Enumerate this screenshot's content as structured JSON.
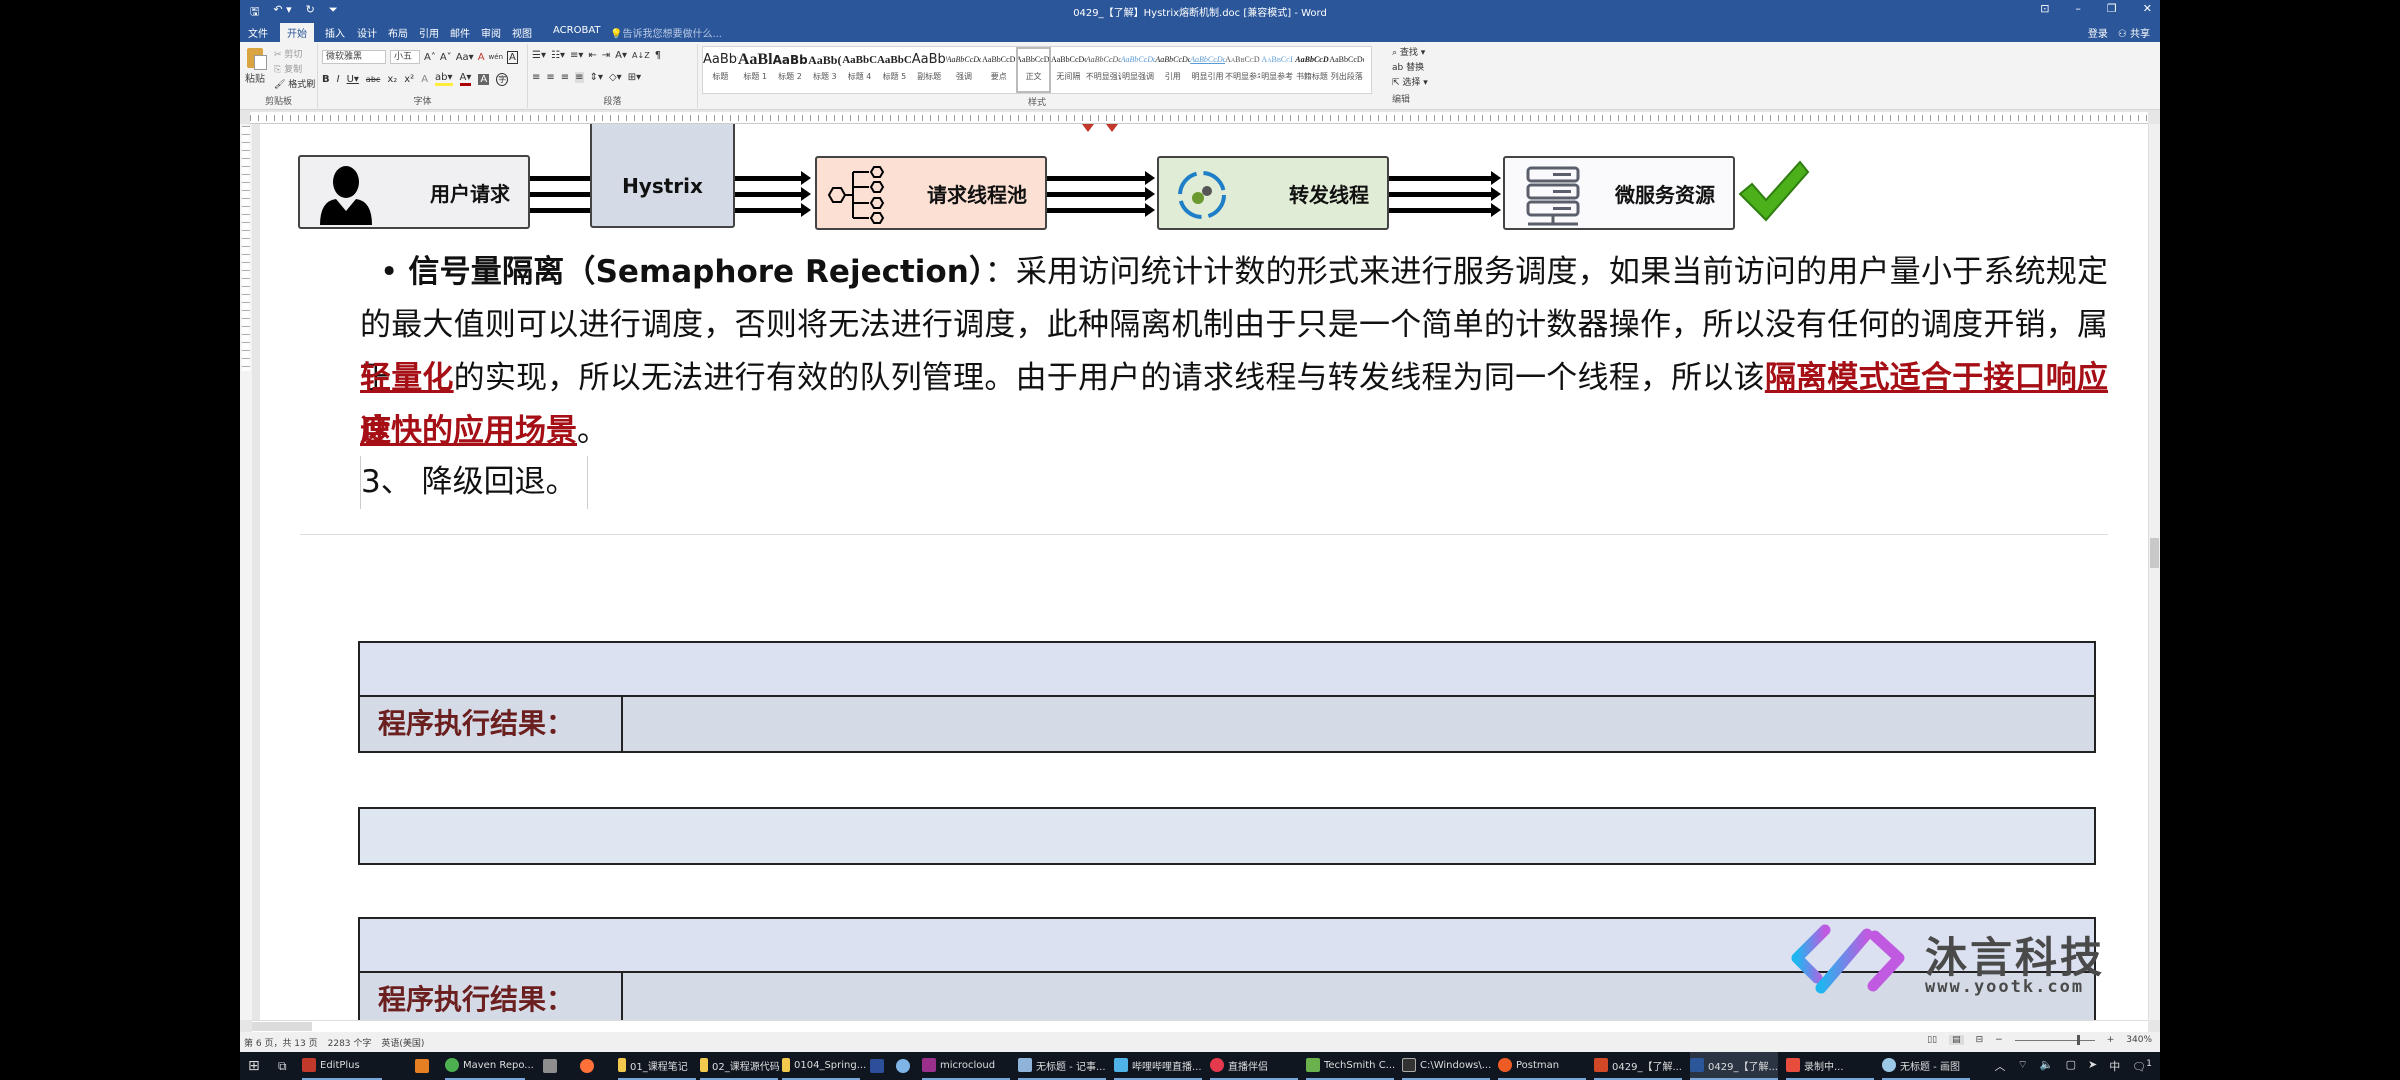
{
  "window": {
    "title": "0429_【了解】Hystrix熔断机制.doc [兼容模式] - Word",
    "qat": {
      "save": "🖫",
      "undo": "↶ ▾",
      "redo": "↻",
      "customize": "⏷"
    },
    "controls": {
      "ribbon_options": "⊡",
      "minimize": "–",
      "restore": "❐",
      "close": "✕"
    }
  },
  "tabs": [
    {
      "label": "文件"
    },
    {
      "label": "开始",
      "active": true
    },
    {
      "label": "插入"
    },
    {
      "label": "设计"
    },
    {
      "label": "布局"
    },
    {
      "label": "引用"
    },
    {
      "label": "邮件"
    },
    {
      "label": "审阅"
    },
    {
      "label": "视图"
    },
    {
      "label": "ACROBAT"
    }
  ],
  "tell_me": "告诉我您想要做什么...",
  "account": {
    "login": "登录",
    "share": "共享"
  },
  "ribbon": {
    "clipboard": {
      "paste": "粘贴",
      "cut": "剪切",
      "copy": "复制",
      "format_painter": "格式刷",
      "label": "剪贴板"
    },
    "font": {
      "name": "微软雅黑",
      "size": "小五",
      "label": "字体",
      "buttons": [
        "A˄",
        "A˅",
        "Aa▾",
        "A",
        "wén",
        "A",
        "B",
        "I",
        "U▾",
        "abc",
        "x₂",
        "x²",
        "A",
        "ab▾",
        "A▾",
        "A",
        "字"
      ]
    },
    "paragraph": {
      "label": "段落",
      "buttons": [
        "☰▾",
        "☷▾",
        "≡▾",
        "⇤",
        "⇥",
        "A▾",
        "A↓Z",
        "¶",
        "≡",
        "≡",
        "≡",
        "≡",
        "⇕▾",
        "◇▾",
        "⊞▾"
      ]
    },
    "styles": {
      "label": "样式",
      "items": [
        {
          "preview": "AaBbC",
          "name": "标题"
        },
        {
          "preview": "AaBl",
          "name": "标题 1"
        },
        {
          "preview": "AaBb(",
          "name": "标题 2"
        },
        {
          "preview": "AaBb(",
          "name": "标题 3"
        },
        {
          "preview": "AaBbC(",
          "name": "标题 4"
        },
        {
          "preview": "AaBbC",
          "name": "标题 5"
        },
        {
          "preview": "AaBbC",
          "name": "副标题"
        },
        {
          "preview": "AaBbCcDc",
          "name": "强调"
        },
        {
          "preview": "AaBbCcD",
          "name": "要点"
        },
        {
          "preview": "AaBbCcDc",
          "name": "正文",
          "selected": true
        },
        {
          "preview": "AaBbCcDc",
          "name": "无间隔"
        },
        {
          "preview": "AaBbCcDc",
          "name": "不明显强调"
        },
        {
          "preview": "AaBbCcDc",
          "name": "明显强调"
        },
        {
          "preview": "AaBbCcDc",
          "name": "引用"
        },
        {
          "preview": "AaBbCcDc",
          "name": "明显引用"
        },
        {
          "preview": "AaBbCcD",
          "name": "不明显参考"
        },
        {
          "preview": "AaBbCcI",
          "name": "明显参考"
        },
        {
          "preview": "AaBbCcD",
          "name": "书籍标题"
        },
        {
          "preview": "AaBbCcDc",
          "name": "列出段落"
        }
      ]
    },
    "editing": {
      "find": "查找",
      "replace": "替换",
      "select": "选择",
      "label": "编辑"
    }
  },
  "diagram": {
    "boxes": [
      {
        "label": "用户请求",
        "color": "#f0f0f3"
      },
      {
        "label": "Hystrix",
        "color": "#d5dbe6"
      },
      {
        "label": "请求线程池",
        "color": "#fbe0d3"
      },
      {
        "label": "转发线程",
        "color": "#e0ecd5"
      },
      {
        "label": "微服务资源",
        "color": "#fafafd"
      }
    ]
  },
  "content": {
    "bullet": "•",
    "term": "信号量隔离（Semaphore Rejection）",
    "colon": "：",
    "line1_rest": "采用访问统计计数的形式来进行服务调度，如果当前访问的用户量小于系统规定",
    "line2": "的最大值则可以进行调度，否则将无法进行调度，此种隔离机制由于只是一个简单的计数器操作，所以没有任何的调度开销，属于",
    "highlight1": "轻量化",
    "line3_mid": "的实现，所以无法进行有效的队列管理。由于用户的请求线程与转发线程为同一个线程，所以该",
    "highlight2a": "隔离模式适合于接口响应速",
    "highlight2b": "度快的应用场景",
    "end": "。",
    "heading3": "3、  降级回退。",
    "result_label": "程序执行结果："
  },
  "watermark": {
    "name": "沐言科技",
    "url": "www.yootk.com"
  },
  "statusbar": {
    "page": "第 6 页，共 13 页",
    "words": "2283 个字",
    "language": "英语(美国)",
    "zoom": "340%",
    "zoom_out": "−",
    "zoom_in": "+"
  },
  "taskbar": {
    "items": [
      {
        "label": "EditPlus",
        "color": "#c0392b"
      },
      {
        "label": "",
        "color": "#e67e22"
      },
      {
        "label": "Maven Repo...",
        "color": "#4caf50"
      },
      {
        "label": "",
        "color": "#8e8e8e"
      },
      {
        "label": "",
        "color": "#ff7139"
      },
      {
        "label": "01_课程笔记",
        "color": "#f2c94c"
      },
      {
        "label": "02_课程源代码",
        "color": "#f2c94c"
      },
      {
        "label": "0104_Spring...",
        "color": "#f2c94c"
      },
      {
        "label": "",
        "color": "#2d4e9a"
      },
      {
        "label": "",
        "color": "#7fb5e6"
      },
      {
        "label": "microcloud",
        "color": "#9b2f8c"
      },
      {
        "label": "无标题 - 记事...",
        "color": "#8fb4d9"
      },
      {
        "label": "哔哩哔哩直播...",
        "color": "#4fb3e8"
      },
      {
        "label": "直播伴侣",
        "color": "#e5394d"
      },
      {
        "label": "TechSmith C...",
        "color": "#6ab04c"
      },
      {
        "label": "C:\\Windows\\...",
        "color": "#333"
      },
      {
        "label": "Postman",
        "color": "#ef5b25"
      },
      {
        "label": "0429_【了解...",
        "color": "#d24726"
      },
      {
        "label": "0429_【了解...",
        "color": "#2b579a",
        "active": true
      },
      {
        "label": "录制中...",
        "color": "#e74c3c"
      },
      {
        "label": "无标题 - 画图",
        "color": "#9cc8e8"
      }
    ],
    "tray": {
      "chevron": "︿",
      "network": "⌔",
      "volume": "🔈",
      "ime_mode": "中",
      "notification_count": "1"
    }
  }
}
